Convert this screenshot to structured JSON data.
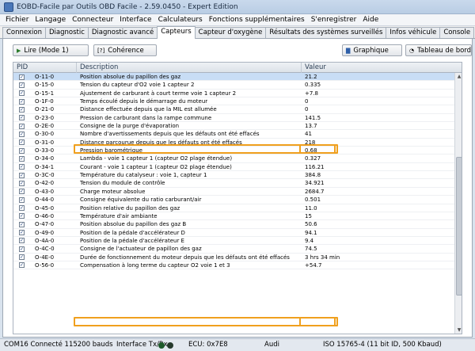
{
  "window": {
    "title": "EOBD-Facile par Outils OBD Facile - 2.59.0450 - Expert Edition"
  },
  "menu": [
    "Fichier",
    "Langage",
    "Connecteur",
    "Interface",
    "Calculateurs",
    "Fonctions supplémentaires",
    "S'enregistrer",
    "Aide"
  ],
  "tabs": [
    "Connexion",
    "Diagnostic",
    "Diagnostic avancé",
    "Capteurs",
    "Capteur d'oxygène",
    "Résultats des systèmes surveillés",
    "Infos véhicule",
    "Console"
  ],
  "active_tab": "Capteurs",
  "toolbar": {
    "read_label": "Lire (Mode 1)",
    "coherence_label": "Cohérence",
    "graph_label": "Graphique",
    "dashboard_label": "Tableau de bord",
    "read_icon": "play-icon",
    "coherence_icon": "help-icon",
    "graph_icon": "chart-icon",
    "dashboard_icon": "dashboard-icon"
  },
  "table": {
    "columns": {
      "pid": "PID",
      "description": "Description",
      "value": "Valeur"
    },
    "rows": [
      {
        "pid": "O-11-0",
        "description": "Position absolue du papillon des gaz",
        "value": "21.2",
        "checked": true
      },
      {
        "pid": "O-15-0",
        "description": "Tension du capteur d'O2 voie 1 capteur 2",
        "value": "0.335",
        "checked": true
      },
      {
        "pid": "O-15-1",
        "description": "Ajustement de carburant à court terme voie 1 capteur 2",
        "value": "+7.8",
        "checked": true
      },
      {
        "pid": "O-1F-0",
        "description": "Temps écoulé depuis le démarrage du moteur",
        "value": "0",
        "checked": true
      },
      {
        "pid": "O-21-0",
        "description": "Distance effectuée depuis que la MIL est allumée",
        "value": "0",
        "checked": true
      },
      {
        "pid": "O-23-0",
        "description": "Pression de carburant dans la rampe commune",
        "value": "141.5",
        "checked": true
      },
      {
        "pid": "O-2E-0",
        "description": "Consigne de la purge d'évaporation",
        "value": "13.7",
        "checked": true
      },
      {
        "pid": "O-30-0",
        "description": "Nombre d'avertissements depuis que les défauts ont été effacés",
        "value": "41",
        "checked": true
      },
      {
        "pid": "O-31-0",
        "description": "Distance parcourue depuis que les défauts ont été effacés",
        "value": "218",
        "checked": true
      },
      {
        "pid": "O-33-0",
        "description": "Pression barométrique",
        "value": "0.68",
        "checked": true
      },
      {
        "pid": "O-34-0",
        "description": "Lambda - voie 1 capteur 1 (capteur O2 plage étendue)",
        "value": "0.327",
        "checked": true
      },
      {
        "pid": "O-34-1",
        "description": "Courant - voie 1 capteur 1 (capteur O2 plage étendue)",
        "value": "116.21",
        "checked": true
      },
      {
        "pid": "O-3C-0",
        "description": "Température du catalyseur : voie 1, capteur 1",
        "value": "384.8",
        "checked": true
      },
      {
        "pid": "O-42-0",
        "description": "Tension du module de contrôle",
        "value": "34.921",
        "checked": true
      },
      {
        "pid": "O-43-0",
        "description": "Charge moteur absolue",
        "value": "2684.7",
        "checked": true
      },
      {
        "pid": "O-44-0",
        "description": "Consigne équivalente du ratio carburant/air",
        "value": "0.501",
        "checked": true
      },
      {
        "pid": "O-45-0",
        "description": "Position relative du papillon des gaz",
        "value": "11.0",
        "checked": true
      },
      {
        "pid": "O-46-0",
        "description": "Température d'air ambiante",
        "value": "15",
        "checked": true
      },
      {
        "pid": "O-47-0",
        "description": "Position absolue du papillon des gaz B",
        "value": "50.6",
        "checked": true
      },
      {
        "pid": "O-49-0",
        "description": "Position de la pédale d'accélérateur D",
        "value": "94.1",
        "checked": true
      },
      {
        "pid": "O-4A-0",
        "description": "Position de la pédale d'accélérateur E",
        "value": "9.4",
        "checked": true
      },
      {
        "pid": "O-4C-0",
        "description": "Consigne de l'actuateur de papillon des gaz",
        "value": "74.5",
        "checked": true
      },
      {
        "pid": "O-4E-0",
        "description": "Durée de fonctionnement du moteur depuis que les défauts ont été effacés",
        "value": "3 hrs 34 min",
        "checked": true
      },
      {
        "pid": "O-56-0",
        "description": "Compensation à long terme du capteur O2 voie 1 et 3",
        "value": "+54.7",
        "checked": true
      }
    ]
  },
  "status": {
    "connection": "COM16 Connecté 115200 bauds",
    "interface": "Interface Tx/Rx",
    "ecu": "ECU: 0x7E8",
    "make": "Audi",
    "protocol": "ISO 15765-4 (11 bit ID, 500 Kbaud)"
  },
  "colors": {
    "highlight": "#f0a01e",
    "selected_row": "#c8ddf5",
    "led_tx": "#1e5a2a",
    "led_rx": "#263a2c"
  }
}
